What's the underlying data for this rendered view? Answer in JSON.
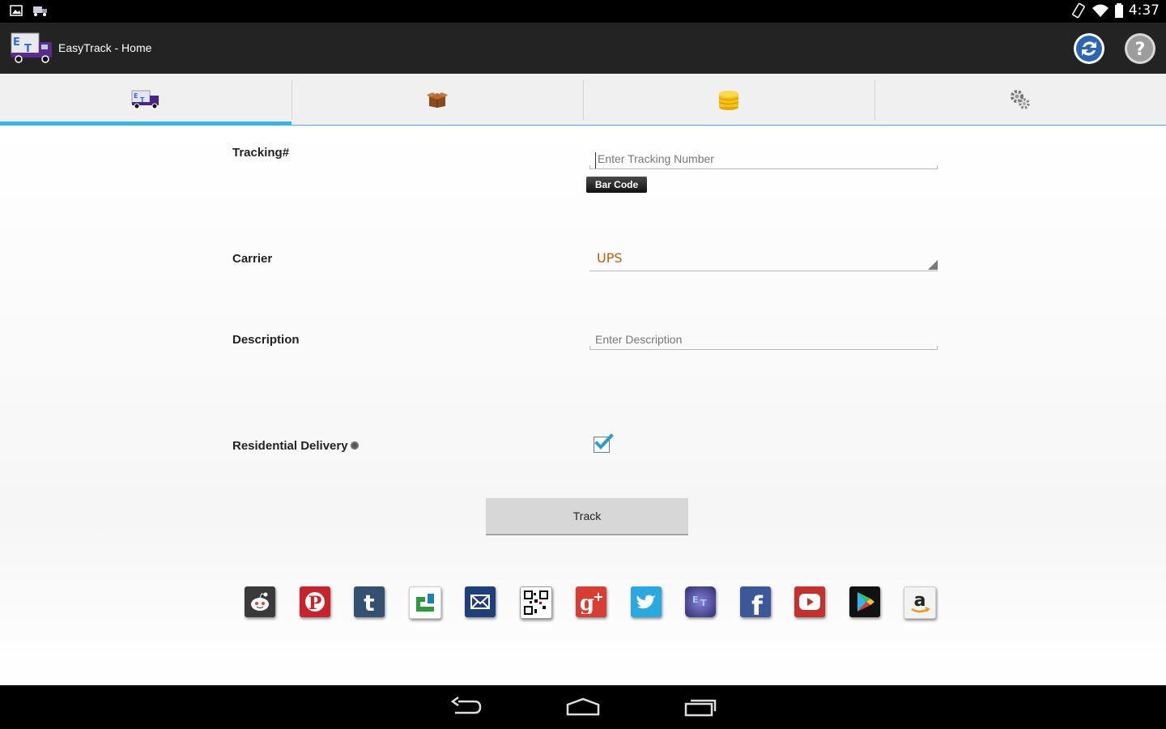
{
  "status_bar": {
    "time": "4:37"
  },
  "action_bar": {
    "app_title": "EasyTrack - Home"
  },
  "tabs": [
    {
      "name": "track",
      "icon": "truck-icon",
      "active": true
    },
    {
      "name": "packages",
      "icon": "box-icon",
      "active": false
    },
    {
      "name": "coins",
      "icon": "coins-icon",
      "active": false
    },
    {
      "name": "settings",
      "icon": "gears-icon",
      "active": false
    }
  ],
  "form": {
    "tracking_label": "Tracking#",
    "tracking_placeholder": "Enter Tracking Number",
    "tracking_value": "",
    "barcode_label": "Bar Code",
    "carrier_label": "Carrier",
    "carrier_value": "UPS",
    "description_label": "Description",
    "description_placeholder": "Enter Description",
    "description_value": "",
    "residential_label": "Residential Delivery",
    "residential_checked": true,
    "track_label": "Track"
  },
  "social_icons": [
    "reddit-icon",
    "pinterest-icon",
    "tumblr-icon",
    "stumbleupon-icon",
    "email-icon",
    "qr-code-icon",
    "google-plus-icon",
    "twitter-icon",
    "easytrack-icon",
    "facebook-icon",
    "youtube-icon",
    "google-play-icon",
    "amazon-icon"
  ],
  "colors": {
    "accent": "#33b5e5",
    "carrier_text": "#c45c0a",
    "action_bar": "#232323"
  }
}
